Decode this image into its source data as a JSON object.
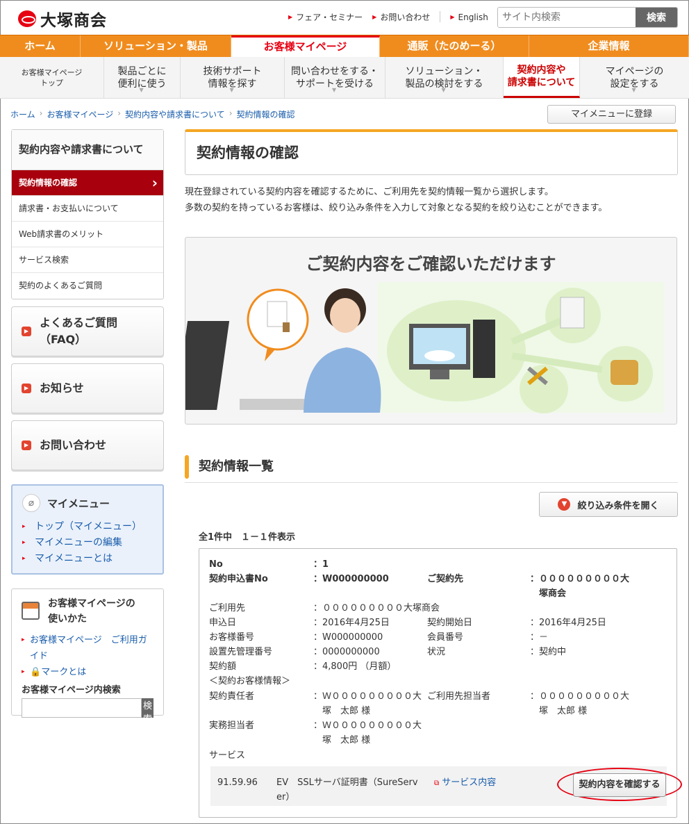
{
  "header": {
    "logo": "大塚商会",
    "links": [
      "フェア・セミナー",
      "お問い合わせ",
      "English"
    ],
    "search_placeholder": "サイト内検索",
    "search_button": "検索"
  },
  "mainnav": [
    "ホーム",
    "ソリューション・製品",
    "お客様マイページ",
    "通販（たのめーる）",
    "企業情報"
  ],
  "subnav": [
    "お客様マイページ\nトップ",
    "製品ごとに\n便利に使う",
    "技術サポート\n情報を探す",
    "問い合わせをする・\nサポートを受ける",
    "ソリューション・\n製品の検討をする",
    "契約内容や\n請求書について",
    "マイページの\n設定をする"
  ],
  "breadcrumb": [
    "ホーム",
    "お客様マイページ",
    "契約内容や請求書について",
    "契約情報の確認"
  ],
  "mymenu_register": "マイメニューに登録",
  "sidebar": {
    "title": "契約内容や請求書について",
    "items": [
      "契約情報の確認",
      "請求書・お支払いについて",
      "Web請求書のメリット",
      "サービス検索",
      "契約のよくあるご質問"
    ],
    "faq": "よくあるご質問\n（FAQ）",
    "news": "お知らせ",
    "contact": "お問い合わせ",
    "mymenu_title": "マイメニュー",
    "mymenu_links": [
      "トップ（マイメニュー）",
      "マイメニューの編集",
      "マイメニューとは"
    ],
    "guide_title": "お客様マイページの\n使いかた",
    "guide_links": [
      "お客様マイページ　ご利用ガイド",
      "マークとは"
    ],
    "guide_search_title": "お客様マイページ内検索",
    "guide_search_button": "検索"
  },
  "page": {
    "title": "契約情報の確認",
    "intro1": "現在登録されている契約内容を確認するために、ご利用先を契約情報一覧から選択します。",
    "intro2": "多数の契約を持っているお客様は、絞り込み条件を入力して対象となる契約を絞り込むことができます。",
    "banner_title": "ご契約内容をご確認いただけます",
    "list_title": "契約情報一覧",
    "filter_button": "絞り込み条件を開く",
    "count": "全1件中　１－１件表示"
  },
  "contract": {
    "no_label": "No",
    "no": "：1",
    "app_label": "契約申込書No",
    "app": "：W000000000",
    "party_label": "ご契約先",
    "party": "：０００００００００大\n　塚商会",
    "user_label": "ご利用先",
    "user": "：０００００００００大塚商会",
    "date_label": "申込日",
    "date": "：2016年4月25日",
    "start_label": "契約開始日",
    "start": "：2016年4月25日",
    "cust_label": "お客様番号",
    "cust": "：W000000000",
    "member_label": "会員番号",
    "member": "：－",
    "site_label": "設置先管理番号",
    "site": "：0000000000",
    "status_label": "状況",
    "status": "：契約中",
    "amount_label": "契約額",
    "amount": "：4,800円 （月額）",
    "info_label": "＜契約お客様情報＞",
    "resp_label": "契約責任者",
    "resp": "：Ｗ０００００００００大\n　塚　太郎 様",
    "user_contact_label": "ご利用先担当者",
    "user_contact": "：０００００００００大\n　塚　太郎 様",
    "work_label": "実務担当者",
    "work": "：Ｗ０００００００００大\n　塚　太郎 様",
    "service_label": "サービス",
    "svc_code": "91.59.96",
    "svc_name": "EV　SSLサーバ証明書（SureServ\ner）",
    "svc_link": "サービス内容",
    "confirm_button": "契約内容を確認する"
  }
}
